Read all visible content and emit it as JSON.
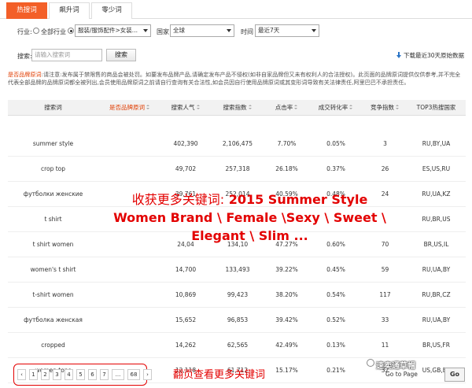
{
  "tabs": [
    {
      "label": "热搜词",
      "active": true
    },
    {
      "label": "飙升词",
      "active": false
    },
    {
      "label": "零少词",
      "active": false
    }
  ],
  "filters": {
    "industry_label": "行业:",
    "all_industry": "全部行业",
    "industry_select": "服装/服饰配件>女装...",
    "country_label": "国家",
    "country_select": "全球",
    "time_label": "时间",
    "time_select": "最近7天"
  },
  "search": {
    "label": "搜索:",
    "placeholder": "请输入搜索词",
    "button": "搜索",
    "download": "下载最近30天原始数据"
  },
  "notice": {
    "highlight": "是否品牌原词",
    "text": ":请注意:发布属于禁限售的商品会被处罚。如要发布品牌产品,请确定发布产品不侵权(如非自家品牌但又未有权利人的合法授权)。此页面的品牌原词提供仅供参考,并不完全代表全部品牌的品牌原词都全被列出,会员使用品牌原词之前请自行查询有关合法性,如会员因自行使用品牌原词或其变形词导致有关法律责任,阿里巴巴不承担责任。"
  },
  "table": {
    "headers": [
      "搜索词",
      "是否品牌原词",
      "搜索人气",
      "搜索指数",
      "点击率",
      "成交转化率",
      "竞争指数",
      "TOP3热搜国家"
    ],
    "rows": [
      [
        "summer style",
        "N",
        "402,390",
        "2,106,475",
        "7.70%",
        "0.05%",
        "3",
        "RU,BY,UA"
      ],
      [
        "crop top",
        "N",
        "49,702",
        "257,318",
        "26.18%",
        "0.37%",
        "26",
        "ES,US,RU"
      ],
      [
        "футболки женские",
        "N",
        "39,761",
        "252,014",
        "40.59%",
        "0.48%",
        "24",
        "RU,UA,KZ"
      ],
      [
        "t shirt",
        "N",
        "",
        "",
        "",
        "",
        "",
        "RU,BR,US"
      ],
      [
        "t shirt women",
        "N",
        "24,04",
        "134,10",
        "47.27%",
        "0.60%",
        "70",
        "BR,US,IL"
      ],
      [
        "women's t shirt",
        "N",
        "14,700",
        "133,493",
        "39.22%",
        "0.45%",
        "59",
        "RU,UA,BY"
      ],
      [
        "t-shirt women",
        "N",
        "10,869",
        "99,423",
        "38.20%",
        "0.54%",
        "117",
        "RU,BR,CZ"
      ],
      [
        "футболка женская",
        "N",
        "15,652",
        "96,853",
        "39.42%",
        "0.52%",
        "33",
        "RU,UA,BY"
      ],
      [
        "cropped",
        "N",
        "14,262",
        "62,565",
        "42.49%",
        "0.13%",
        "11",
        "BR,US,FR"
      ],
      [
        "women tops",
        "N",
        "12,118",
        "61,712",
        "15.17%",
        "0.21%",
        "32",
        "US,GB,ES"
      ]
    ]
  },
  "overlay": {
    "cn_part": "收获更多关键词:",
    "line1_rest": "2015 Summer Style",
    "line2": "Women Brand \\ Female \\Sexy \\ Sweet \\",
    "line3": "Elegant \\ Slim ..."
  },
  "pager": {
    "prev": "‹",
    "pages": [
      "1",
      "2",
      "3",
      "4",
      "5",
      "6",
      "7",
      "...",
      "68"
    ],
    "next": "›",
    "note": "翻页查看更多关键词",
    "goto": "Go to Page",
    "go": "Go"
  },
  "watermark": "速卖通草帽"
}
